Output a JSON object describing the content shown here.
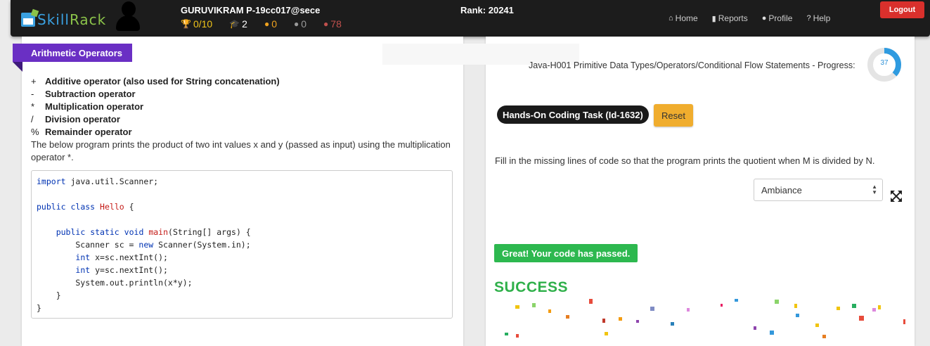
{
  "nav": {
    "logo_left": "Skill",
    "logo_right": "Rack",
    "user": "GURUVIKRAM P-19cc017@sece",
    "rank": "Rank: 20241",
    "stats": [
      {
        "icon": "trophy-icon",
        "value": "0/10",
        "color": "#f0c419"
      },
      {
        "icon": "graduation-cap-icon",
        "value": "2",
        "color": "#ffffff"
      },
      {
        "icon": "medal-gold-icon",
        "value": "0",
        "color": "#f0a21f"
      },
      {
        "icon": "medal-silver-icon",
        "value": "0",
        "color": "#9a9a9a"
      },
      {
        "icon": "medal-bronze-icon",
        "value": "78",
        "color": "#c0504d"
      }
    ],
    "links": [
      {
        "icon": "home-icon",
        "label": "Home"
      },
      {
        "icon": "bar-chart-icon",
        "label": "Reports"
      },
      {
        "icon": "user-icon",
        "label": "Profile"
      },
      {
        "icon": "help-icon",
        "label": "Help"
      }
    ],
    "logout": "Logout"
  },
  "lesson": {
    "title": "Arithmetic Operators",
    "operators": [
      {
        "symbol": "+",
        "text": "Additive operator (also used for String concatenation)"
      },
      {
        "symbol": "-",
        "text": "Subtraction operator"
      },
      {
        "symbol": "*",
        "text": "Multiplication operator"
      },
      {
        "symbol": "/",
        "text": "Division operator"
      },
      {
        "symbol": "%",
        "text": "Remainder operator"
      }
    ],
    "description": "The below program prints the product of two int values x and y (passed as input) using the multiplication operator *.",
    "code_lines": [
      "import java.util.Scanner;",
      "",
      "public class Hello {",
      "",
      "    public static void main(String[] args) {",
      "        Scanner sc = new Scanner(System.in);",
      "        int x=sc.nextInt();",
      "        int y=sc.nextInt();",
      "        System.out.println(x*y);",
      "    }",
      "}"
    ]
  },
  "task": {
    "progress_label": "Java-H001 Primitive Data Types/Operators/Conditional Flow Statements - Progress:",
    "progress_value": "37",
    "progress_fraction": 0.37,
    "task_label": "Hands-On Coding Task (Id-1632)",
    "reset": "Reset",
    "question": "Fill in the missing lines of code so that the program prints the quotient when M is divided by N.",
    "theme": "Ambiance",
    "result_badge": "Great! Your code has passed.",
    "success": "SUCCESS"
  }
}
